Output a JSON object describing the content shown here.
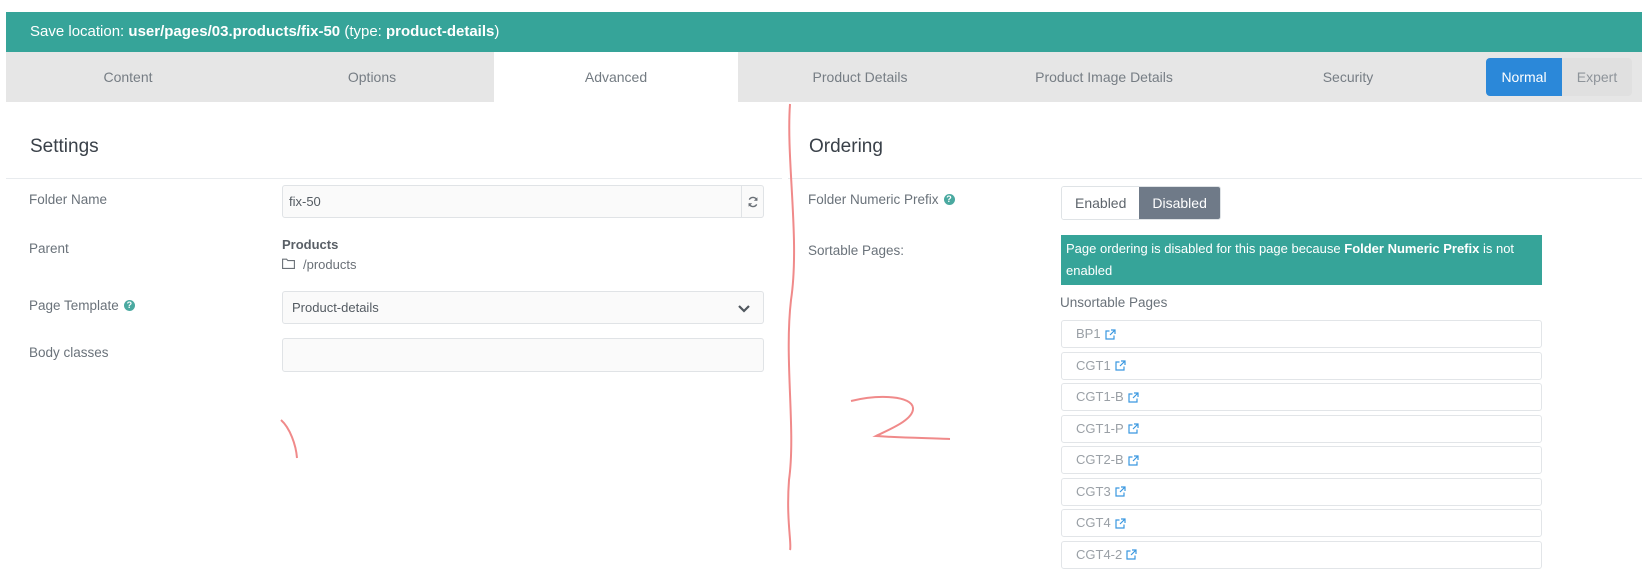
{
  "save_bar": {
    "prefix": "Save location: ",
    "path": "user/pages/03.products/fix-50",
    "type_open": " (type: ",
    "type": "product-details",
    "type_close": ")"
  },
  "tabs": [
    {
      "label": "Content"
    },
    {
      "label": "Options"
    },
    {
      "label": "Advanced"
    },
    {
      "label": "Product Details"
    },
    {
      "label": "Product Image Details"
    },
    {
      "label": "Security"
    }
  ],
  "mode": {
    "normal": "Normal",
    "expert": "Expert"
  },
  "settings": {
    "title": "Settings",
    "folder_name_label": "Folder Name",
    "folder_name_value": "fix-50",
    "parent_label": "Parent",
    "parent_name": "Products",
    "parent_path": "/products",
    "template_label": "Page Template",
    "template_value": "Product-details",
    "body_classes_label": "Body classes",
    "body_classes_value": ""
  },
  "ordering": {
    "title": "Ordering",
    "prefix_label": "Folder Numeric Prefix",
    "enabled": "Enabled",
    "disabled": "Disabled",
    "sortable_label": "Sortable Pages:",
    "notice_before": "Page ordering is disabled for this page because ",
    "notice_bold": "Folder Numeric Prefix",
    "notice_after": " is not enabled",
    "unsortable_title": "Unsortable Pages",
    "pages": [
      "BP1",
      "CGT1",
      "CGT1-B",
      "CGT1-P",
      "CGT2-B",
      "CGT3",
      "CGT4",
      "CGT4-2"
    ]
  },
  "icons": {
    "refresh": "refresh-icon",
    "help": "question-circle-icon",
    "folder": "folder-icon",
    "chevron": "chevron-down-icon",
    "external": "external-link-icon"
  },
  "colors": {
    "accent_teal": "#36a499",
    "normal_blue": "#2b88d9",
    "disabled_gray": "#6f7a88",
    "annotation_red": "#f08a8a"
  }
}
